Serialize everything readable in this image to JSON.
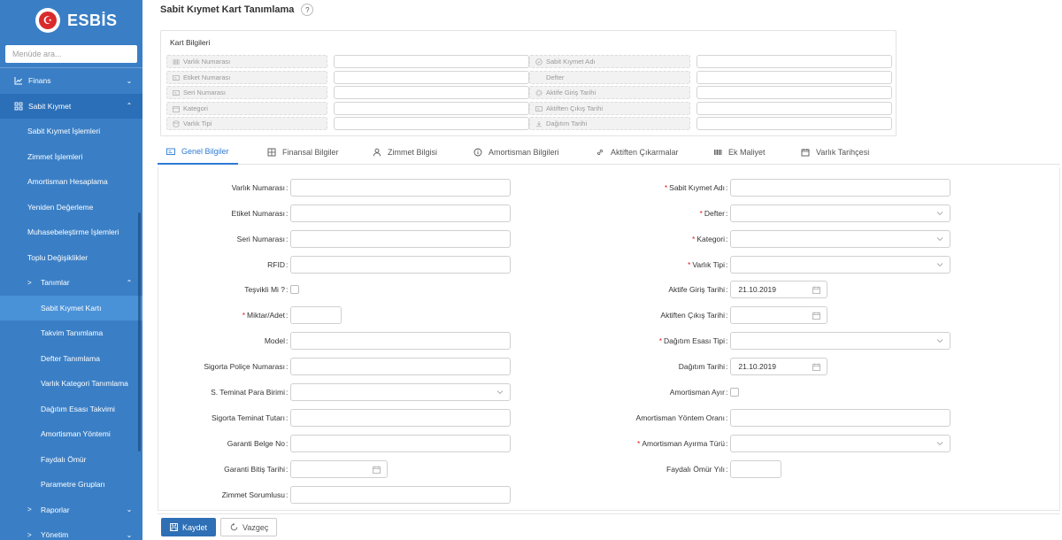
{
  "brand": {
    "name": "ESBİS",
    "logo_glyph": "☪"
  },
  "sidebar": {
    "search_placeholder": "Menüde ara...",
    "items": [
      {
        "label": "Finans",
        "chevron": "⌄"
      },
      {
        "label": "Sabit Kıymet",
        "chevron": "⌃"
      },
      {
        "label": "Sabit Kıymet İşlemleri"
      },
      {
        "label": "Zimmet İşlemleri"
      },
      {
        "label": "Amortisman Hesaplama"
      },
      {
        "label": "Yeniden Değerleme"
      },
      {
        "label": "Muhasebeleştirme İşlemleri"
      },
      {
        "label": "Toplu Değişiklikler"
      },
      {
        "label": "Tanımlar",
        "arrow": ">",
        "chevron": "⌃"
      },
      {
        "label": "Sabit Kıymet Kartı"
      },
      {
        "label": "Takvim Tanımlama"
      },
      {
        "label": "Defter Tanımlama"
      },
      {
        "label": "Varlık Kategori Tanımlama"
      },
      {
        "label": "Dağıtım Esası Takvimi"
      },
      {
        "label": "Amortisman Yöntemi"
      },
      {
        "label": "Faydalı Ömür"
      },
      {
        "label": "Parametre Grupları"
      },
      {
        "label": "Raporlar",
        "arrow": ">",
        "chevron": "⌄"
      },
      {
        "label": "Yönetim",
        "arrow": ">",
        "chevron": "⌄"
      }
    ]
  },
  "page": {
    "title": "Sabit Kıymet Kart Tanımlama",
    "help": "?"
  },
  "card": {
    "title": "Kart Bilgileri",
    "left": [
      "Varlık Numarası",
      "Etiket Numarası",
      "Seri Numarası",
      "Kategori",
      "Varlık Tipi"
    ],
    "right": [
      "Sabit Kıymet Adı",
      "Defter",
      "Aktife Giriş Tarihi",
      "Aktiften Çıkış Tarihi",
      "Dağıtım Tarihi"
    ]
  },
  "tabs": [
    "Genel Bilgiler",
    "Finansal Bilgiler",
    "Zimmet Bilgisi",
    "Amortisman Bilgileri",
    "Aktiften Çıkarmalar",
    "Ek Maliyet",
    "Varlık Tarihçesi"
  ],
  "form": {
    "colon": ":",
    "required_mark": "*",
    "left": [
      "Varlık Numarası",
      "Etiket Numarası",
      "Seri Numarası",
      "RFID",
      "Teşvikli Mi ?",
      "Miktar/Adet",
      "Model",
      "Sigorta Poliçe Numarası",
      "S. Teminat Para Birimi",
      "Sigorta Teminat Tutarı",
      "Garanti Belge No",
      "Garanti Bitiş Tarihi",
      "Zimmet Sorumlusu"
    ],
    "right": [
      "Sabit Kıymet Adı",
      "Defter",
      "Kategori",
      "Varlık Tipi",
      "Aktife Giriş Tarihi",
      "Aktiften Çıkış Tarihi",
      "Dağıtım Esası Tipi",
      "Dağıtım Tarihi",
      "Amortisman Ayır",
      "Amortisman Yöntem Oranı",
      "Amortisman Ayırma Türü",
      "Faydalı Ömür Yılı"
    ],
    "values": {
      "aktife_giris_tarihi": "21.10.2019",
      "dagitim_tarihi": "21.10.2019"
    }
  },
  "buttons": {
    "save": "Kaydet",
    "cancel": "Vazgeç"
  },
  "colors": {
    "sidebar_bg": "#3a7fc6",
    "accent": "#2d7bd5",
    "primary_btn": "#2e6fb5",
    "required": "#e02020"
  }
}
